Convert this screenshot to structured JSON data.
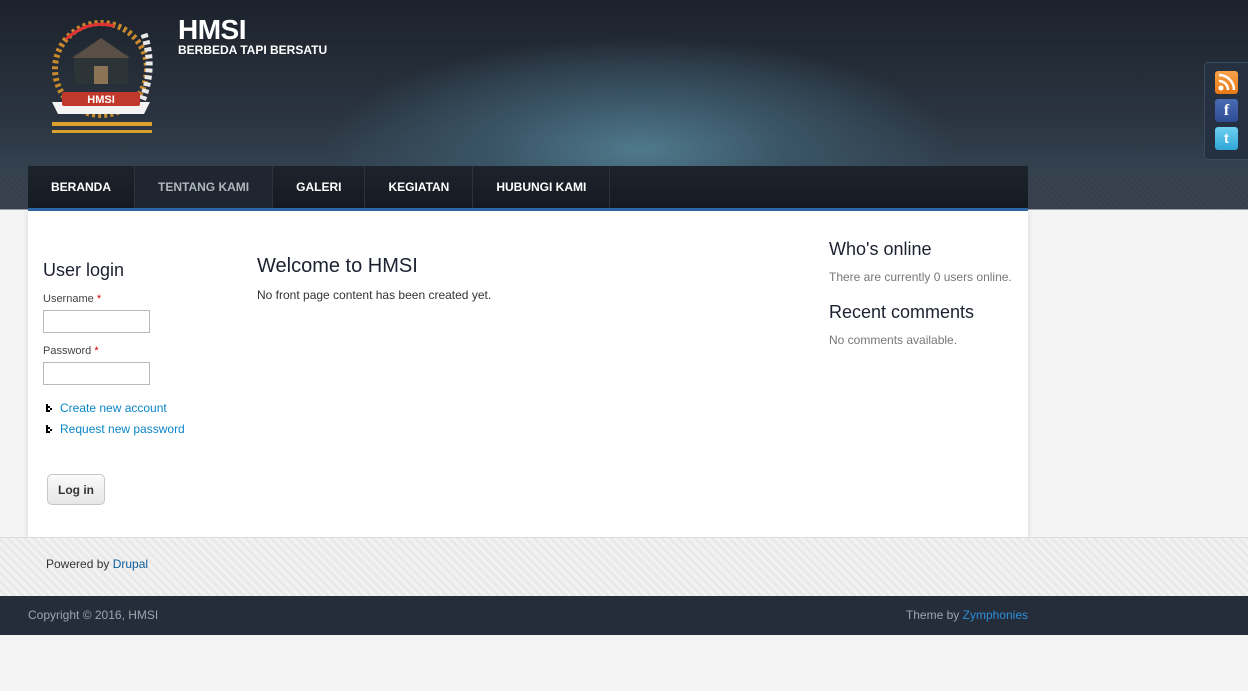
{
  "site": {
    "name": "HMSI",
    "slogan": "BERBEDA TAPI BERSATU",
    "logo_text": "HMSI"
  },
  "nav": {
    "items": [
      {
        "label": "BERANDA"
      },
      {
        "label": "TENTANG KAMI"
      },
      {
        "label": "GALERI"
      },
      {
        "label": "KEGIATAN"
      },
      {
        "label": "HUBUNGI KAMI"
      }
    ],
    "active": "TENTANG KAMI"
  },
  "login": {
    "title": "User login",
    "username_label": "Username",
    "password_label": "Password",
    "required_mark": "*",
    "username_value": "",
    "password_value": "",
    "create_account": "Create new account",
    "request_password": "Request new password",
    "submit_label": "Log in"
  },
  "main": {
    "title": "Welcome to HMSI",
    "message": "No front page content has been created yet."
  },
  "sidebar": {
    "whos_online_title": "Who's online",
    "whos_online_text": "There are currently 0 users online.",
    "recent_comments_title": "Recent comments",
    "recent_comments_text": "No comments available."
  },
  "powered": {
    "prefix": "Powered by",
    "link": "Drupal"
  },
  "footer": {
    "copyright": "Copyright © 2016, HMSI",
    "theme_prefix": "Theme by",
    "theme_link": "Zymphonies"
  },
  "social": {
    "icons": [
      "rss-icon",
      "facebook-icon",
      "twitter-icon"
    ]
  },
  "colors": {
    "accent_link": "#0b86c9",
    "nav_underline": "#2f6aa8",
    "footer_bg": "#262d3a"
  }
}
